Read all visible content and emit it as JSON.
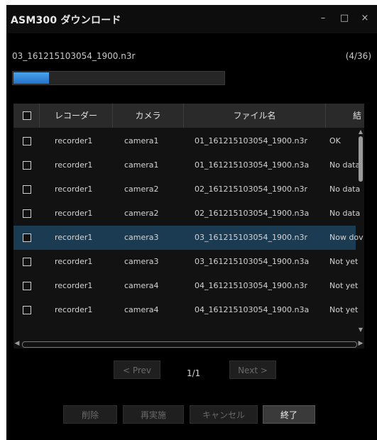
{
  "window": {
    "title": "ASM300 ダウンロード",
    "controls": {
      "minimize": "–",
      "maximize": "□",
      "close": "×"
    }
  },
  "progress": {
    "current_file": "03_161215103054_1900.n3r",
    "count": "(4/36)",
    "fraction": 0.17,
    "color": "#3b8fdc"
  },
  "table": {
    "columns": [
      "レコーダー",
      "カメラ",
      "ファイル名",
      "結"
    ],
    "rows": [
      {
        "recorder": "recorder1",
        "camera": "camera1",
        "file": "01_161215103054_1900.n3r",
        "status": "OK",
        "selected": false
      },
      {
        "recorder": "recorder1",
        "camera": "camera1",
        "file": "01_161215103054_1900.n3a",
        "status": "No data",
        "selected": false
      },
      {
        "recorder": "recorder1",
        "camera": "camera2",
        "file": "02_161215103054_1900.n3r",
        "status": "No data",
        "selected": false
      },
      {
        "recorder": "recorder1",
        "camera": "camera2",
        "file": "02_161215103054_1900.n3a",
        "status": "No data",
        "selected": false
      },
      {
        "recorder": "recorder1",
        "camera": "camera3",
        "file": "03_161215103054_1900.n3r",
        "status": "Now dov",
        "selected": true
      },
      {
        "recorder": "recorder1",
        "camera": "camera3",
        "file": "03_161215103054_1900.n3a",
        "status": "Not yet",
        "selected": false
      },
      {
        "recorder": "recorder1",
        "camera": "camera4",
        "file": "04_161215103054_1900.n3r",
        "status": "Not yet",
        "selected": false
      },
      {
        "recorder": "recorder1",
        "camera": "camera4",
        "file": "04_161215103054_1900.n3a",
        "status": "Not yet",
        "selected": false
      }
    ],
    "selected_row_color": "#1b3b53"
  },
  "pagination": {
    "prev_label": "< Prev",
    "page": "1/1",
    "next_label": "Next >"
  },
  "buttons": {
    "delete": "削除",
    "retry": "再実施",
    "cancel": "キャンセル",
    "finish": "終了"
  }
}
